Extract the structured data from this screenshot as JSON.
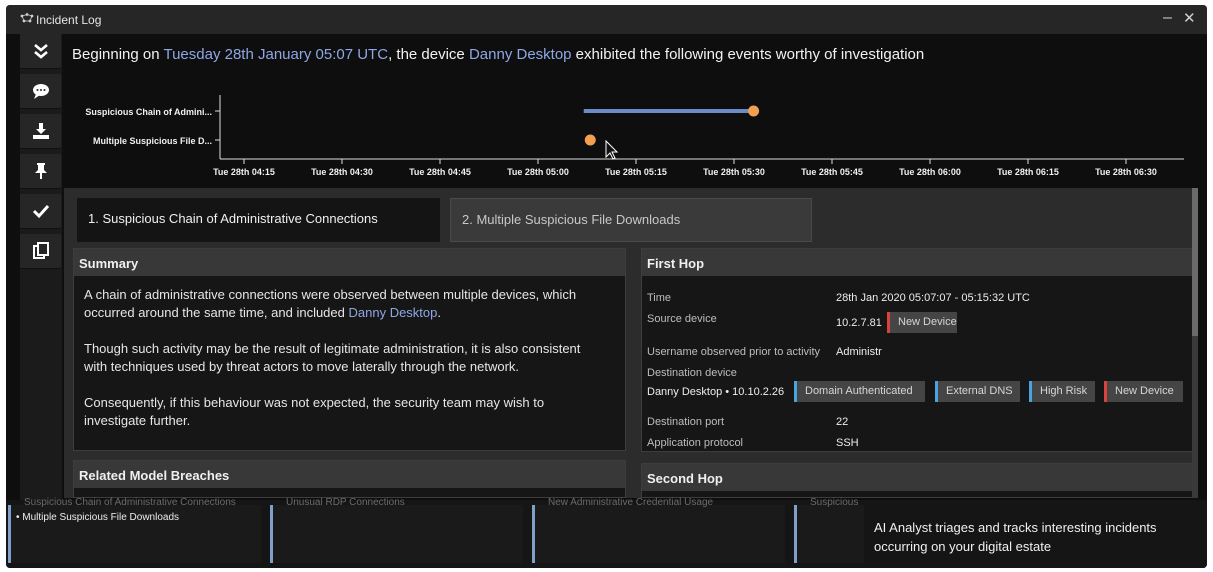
{
  "window": {
    "title": "Incident Log",
    "minimize_label": "–",
    "close_label": "✕"
  },
  "sidebar": {
    "items": [
      {
        "icon": "chevrons-down-icon",
        "label": "Collapse"
      },
      {
        "icon": "comment-icon",
        "label": "Comment"
      },
      {
        "icon": "download-icon",
        "label": "Download"
      },
      {
        "icon": "pin-icon",
        "label": "Pin"
      },
      {
        "icon": "check-icon",
        "label": "Acknowledge"
      },
      {
        "icon": "copy-icon",
        "label": "Copy"
      }
    ]
  },
  "heading": {
    "prefix": "Beginning on ",
    "date": "Tuesday 28th January 05:07 UTC",
    "middle": ", the device ",
    "device": "Danny Desktop",
    "suffix": " exhibited the following events worthy of investigation"
  },
  "timeline": {
    "rows": [
      "Suspicious Chain of Admini...",
      "Multiple Suspicious File D..."
    ],
    "ticks": [
      "Tue 28th 04:15",
      "Tue 28th 04:30",
      "Tue 28th 04:45",
      "Tue 28th 05:00",
      "Tue 28th 05:15",
      "Tue 28th 05:30",
      "Tue 28th 05:45",
      "Tue 28th 06:00",
      "Tue 28th 06:15",
      "Tue 28th 06:30"
    ],
    "events": [
      {
        "row": 0,
        "start": "05:07",
        "end": "05:33"
      },
      {
        "row": 1,
        "start": "05:08",
        "end": "05:08"
      }
    ],
    "colors": {
      "bar": "#6c8bc6",
      "marker": "#f0a050"
    }
  },
  "tabs": [
    {
      "label": "1. Suspicious Chain of Administrative Connections",
      "active": true
    },
    {
      "label": "2. Multiple Suspicious File Downloads",
      "active": false
    }
  ],
  "summary": {
    "title": "Summary",
    "p1_a": "A chain of administrative connections were observed between multiple devices, which",
    "p1_b": "occurred around the same time, and included ",
    "p1_device": "Danny Desktop",
    "p1_end": ".",
    "p2_a": "Though such activity may be the result of legitimate administration, it is also consistent",
    "p2_b": "with techniques used by threat actors to move laterally through the network.",
    "p3_a": "Consequently, if this behaviour was not expected, the security team may wish to",
    "p3_b": "investigate further."
  },
  "related": {
    "title": "Related Model Breaches"
  },
  "first_hop": {
    "title": "First Hop",
    "time_label": "Time",
    "time_value": "28th Jan 2020 05:07:07 - 05:15:32 UTC",
    "source_label": "Source device",
    "source_value": "10.2.7.81",
    "source_tag": "New Device",
    "username_label": "Username observed prior to activity",
    "username_value": "Administr",
    "dest_label": "Destination device",
    "dest_value": "Danny Desktop • 10.10.2.26",
    "dest_tags": [
      "Domain Authenticated",
      "External DNS",
      "High Risk",
      "New Device"
    ],
    "port_label": "Destination port",
    "port_value": "22",
    "protocol_label": "Application protocol",
    "protocol_value": "SSH"
  },
  "second_hop": {
    "title": "Second Hop"
  },
  "bottom_cards": [
    {
      "faded": "Suspicious Chain of Administrative Connections",
      "item": "Multiple Suspicious File Downloads"
    },
    {
      "faded": "Unusual RDP Connections",
      "item": ""
    },
    {
      "faded": "New Administrative Credential Usage",
      "item": ""
    },
    {
      "faded": "Suspicious",
      "item": ""
    }
  ],
  "caption": {
    "line1": "AI Analyst triages and tracks interesting incidents",
    "line2": "occurring on your digital estate"
  },
  "colors": {
    "link": "#8fa7e4",
    "tag_blue": "#4aa3df",
    "tag_red": "#d9443a"
  }
}
